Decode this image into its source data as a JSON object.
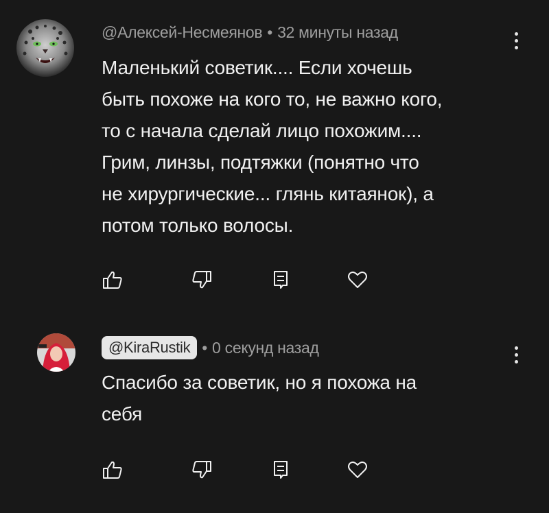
{
  "comments": [
    {
      "author": "@Алексей-Несмеянов",
      "separator": "•",
      "time": "32 минуты назад",
      "text": "Маленький советик.... Если хочешь\nбыть похоже на кого то, не важно кого,\nто с начала сделай лицо похожим....\nГрим, линзы, подтяжки (понятно что\nне хирургические... глянь китаянок), а\nпотом только волосы.",
      "avatar_icon": "snow-leopard-avatar"
    },
    {
      "author": "@KiraRustik",
      "separator": "•",
      "time": "0 секунд назад",
      "text": "Спасибо за советик, но я похожа на\nсебя",
      "avatar_icon": "red-hair-avatar"
    }
  ],
  "actions": [
    "like-icon",
    "dislike-icon",
    "reply-icon",
    "heart-icon"
  ],
  "colors": {
    "background": "#181818",
    "text": "#f1f1f1",
    "meta": "#9e9e9e",
    "chip": "#e6e6e6"
  }
}
